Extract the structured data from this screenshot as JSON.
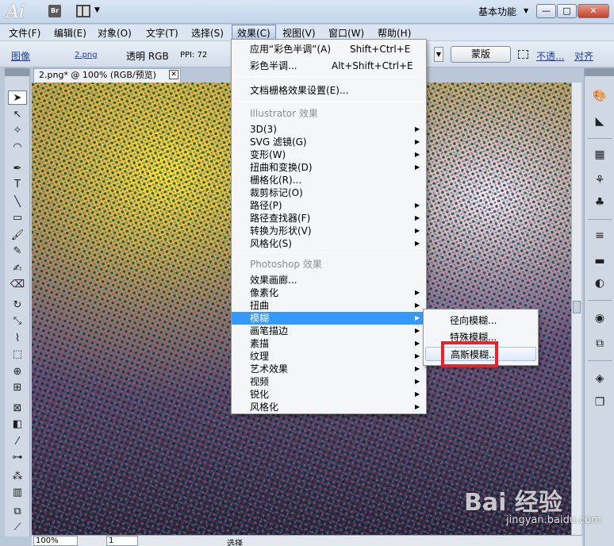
{
  "titlebar": {
    "app_logo": "Ai",
    "bridge_label": "Br",
    "workspace": "基本功能"
  },
  "menubar": [
    "文件(F)",
    "编辑(E)",
    "对象(O)",
    "文字(T)",
    "选择(S)",
    "效果(C)",
    "视图(V)",
    "窗口(W)",
    "帮助(H)"
  ],
  "controlbar": {
    "type_label": "图像",
    "file_name": "2.png",
    "mode": "透明 RGB",
    "ppi": "PPI: 72",
    "mask_button": "蒙版",
    "opacity_link": "不透...",
    "align_link": "对齐"
  },
  "document": {
    "tab_title": "2.png* @ 100% (RGB/预览)"
  },
  "statusbar": {
    "zoom": "100%",
    "page": "1",
    "status": "选择"
  },
  "effect_menu": {
    "apply_last": {
      "label": "应用“彩色半调”(A)",
      "shortcut": "Shift+Ctrl+E"
    },
    "last_effect": {
      "label": "彩色半调...",
      "shortcut": "Alt+Shift+Ctrl+E"
    },
    "doc_raster": "文档栅格效果设置(E)...",
    "illustrator_header": "Illustrator 效果",
    "illustrator_items": [
      "3D(3)",
      "SVG 滤镜(G)",
      "变形(W)",
      "扭曲和变换(D)",
      "栅格化(R)...",
      "裁剪标记(O)",
      "路径(P)",
      "路径查找器(F)",
      "转换为形状(V)",
      "风格化(S)"
    ],
    "photoshop_header": "Photoshop 效果",
    "photoshop_items": [
      "效果画廊...",
      "像素化",
      "扭曲",
      "模糊",
      "画笔描边",
      "素描",
      "纹理",
      "艺术效果",
      "视频",
      "锐化",
      "风格化"
    ]
  },
  "blur_submenu": [
    "径向模糊...",
    "特殊模糊...",
    "高斯模糊..."
  ],
  "watermark": {
    "logo": "Bai 经验",
    "url": "jingyan.baidu.com"
  },
  "colors": {
    "menu_highlight": "#3399ff",
    "annotation_red": "#e8232a"
  }
}
